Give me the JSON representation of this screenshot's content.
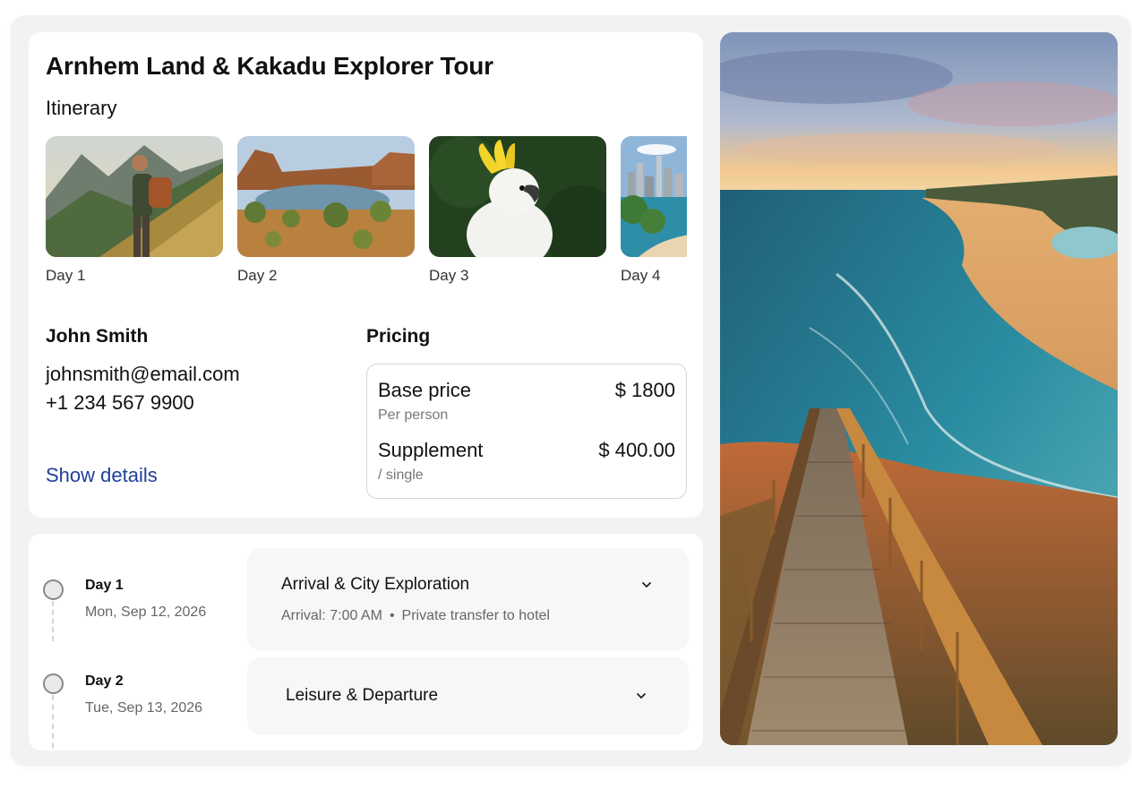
{
  "tour": {
    "title": "Arnhem Land & Kakadu Explorer Tour",
    "itinerary_label": "Itinerary",
    "thumbnails": [
      {
        "caption": "Day 1",
        "image": "hiker-mountain-photo"
      },
      {
        "caption": "Day 2",
        "image": "outback-lake-photo"
      },
      {
        "caption": "Day 3",
        "image": "cockatoo-photo"
      },
      {
        "caption": "Day 4",
        "image": "city-coast-photo"
      }
    ]
  },
  "contact": {
    "name": "John Smith",
    "email": "johnsmith@email.com",
    "phone": "+1 234 567 9900",
    "show_details": "Show details"
  },
  "pricing": {
    "title": "Pricing",
    "base_label": "Base price",
    "base_amount": "$ 1800",
    "base_sub": "Per person",
    "supplement_label": "Supplement",
    "supplement_amount": "$ 400.00",
    "supplement_sub": "/ single"
  },
  "schedule": [
    {
      "day": "Day 1",
      "date": "Mon, Sep 12, 2026",
      "title": "Arrival & City Exploration",
      "meta_arrival": "Arrival: 7:00 AM",
      "meta_separator": "•",
      "meta_transfer": "Private transfer to hotel"
    },
    {
      "day": "Day 2",
      "date": "Tue, Sep 13, 2026",
      "title": "Leisure & Departure"
    }
  ],
  "hero_image": "coastal-boardwalk-beach-sunset-photo",
  "colors": {
    "link": "#1e3f9a",
    "card": "#ffffff",
    "background": "#f2f2f3",
    "accordion": "#f7f7f7"
  }
}
